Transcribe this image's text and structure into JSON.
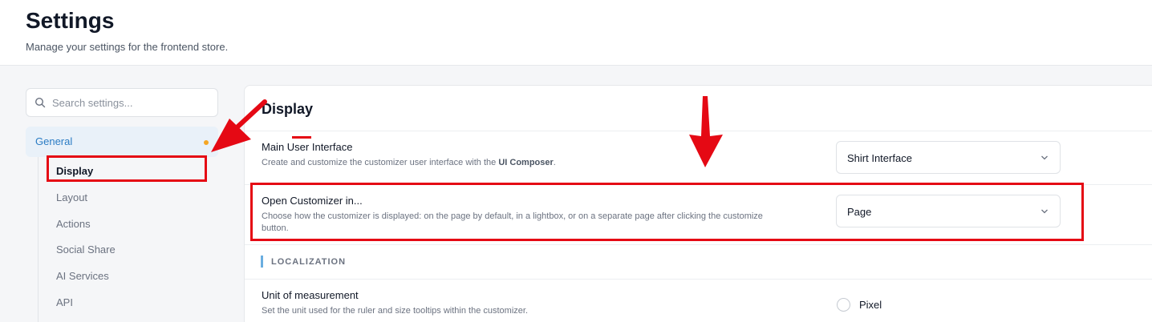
{
  "header": {
    "title": "Settings",
    "subtitle": "Manage your settings for the frontend store."
  },
  "sidebar": {
    "search_placeholder": "Search settings...",
    "group_label": "General",
    "items": [
      {
        "label": "Display",
        "active": true
      },
      {
        "label": "Layout"
      },
      {
        "label": "Actions"
      },
      {
        "label": "Social Share"
      },
      {
        "label": "AI Services"
      },
      {
        "label": "API"
      }
    ]
  },
  "main": {
    "title": "Display",
    "settings": [
      {
        "title": "Main User Interface",
        "description_prefix": "Create and customize the customizer user interface with the ",
        "description_bold": "UI Composer",
        "description_suffix": ".",
        "value": "Shirt Interface"
      },
      {
        "title": "Open Customizer in...",
        "description_line1": "Choose how the customizer is displayed: on the page by default, in a lightbox, or on a separate page after clicking the customize",
        "description_line2": "button.",
        "value": "Page"
      }
    ],
    "section_label": "LOCALIZATION",
    "unit": {
      "title": "Unit of measurement",
      "description": "Set the unit used for the ruler and size tooltips within the customizer.",
      "option_label": "Pixel"
    }
  },
  "colors": {
    "accent": "#2b7cc4",
    "annotation": "#e50914",
    "indicator": "#f5a623"
  },
  "icons": {
    "search": "search-icon",
    "chevron": "chevron-down-icon"
  }
}
